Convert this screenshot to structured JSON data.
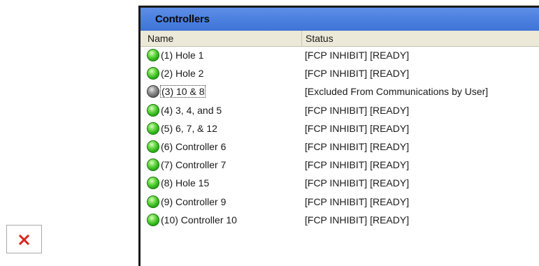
{
  "panel": {
    "title": "Controllers",
    "columns": {
      "name": "Name",
      "status": "Status"
    },
    "rows": [
      {
        "name": "(1)  Hole 1",
        "status": "[FCP INHIBIT] [READY]",
        "indicator": "green"
      },
      {
        "name": "(2)  Hole 2",
        "status": "[FCP INHIBIT] [READY]",
        "indicator": "green"
      },
      {
        "name": "(3)  10 & 8",
        "status": "[Excluded From Communications by User]",
        "indicator": "gray"
      },
      {
        "name": "(4)  3, 4, and 5",
        "status": "[FCP INHIBIT] [READY]",
        "indicator": "green"
      },
      {
        "name": "(5)  6, 7, & 12",
        "status": "[FCP INHIBIT] [READY]",
        "indicator": "green"
      },
      {
        "name": "(6)  Controller 6",
        "status": "[FCP INHIBIT] [READY]",
        "indicator": "green"
      },
      {
        "name": "(7)  Controller 7",
        "status": "[FCP INHIBIT] [READY]",
        "indicator": "green"
      },
      {
        "name": "(8)  Hole 15",
        "status": "[FCP INHIBIT] [READY]",
        "indicator": "green"
      },
      {
        "name": "(9)  Controller 9",
        "status": "[FCP INHIBIT] [READY]",
        "indicator": "green"
      },
      {
        "name": "(10)  Controller 10",
        "status": "[FCP INHIBIT] [READY]",
        "indicator": "green"
      }
    ]
  },
  "broken_image": {
    "icon": "broken-image-icon"
  },
  "colors": {
    "title_bar": "#4a7fdf",
    "status_ok": "#2fb61a",
    "status_excluded": "#6b6b6b",
    "broken_x": "#d9251c"
  }
}
